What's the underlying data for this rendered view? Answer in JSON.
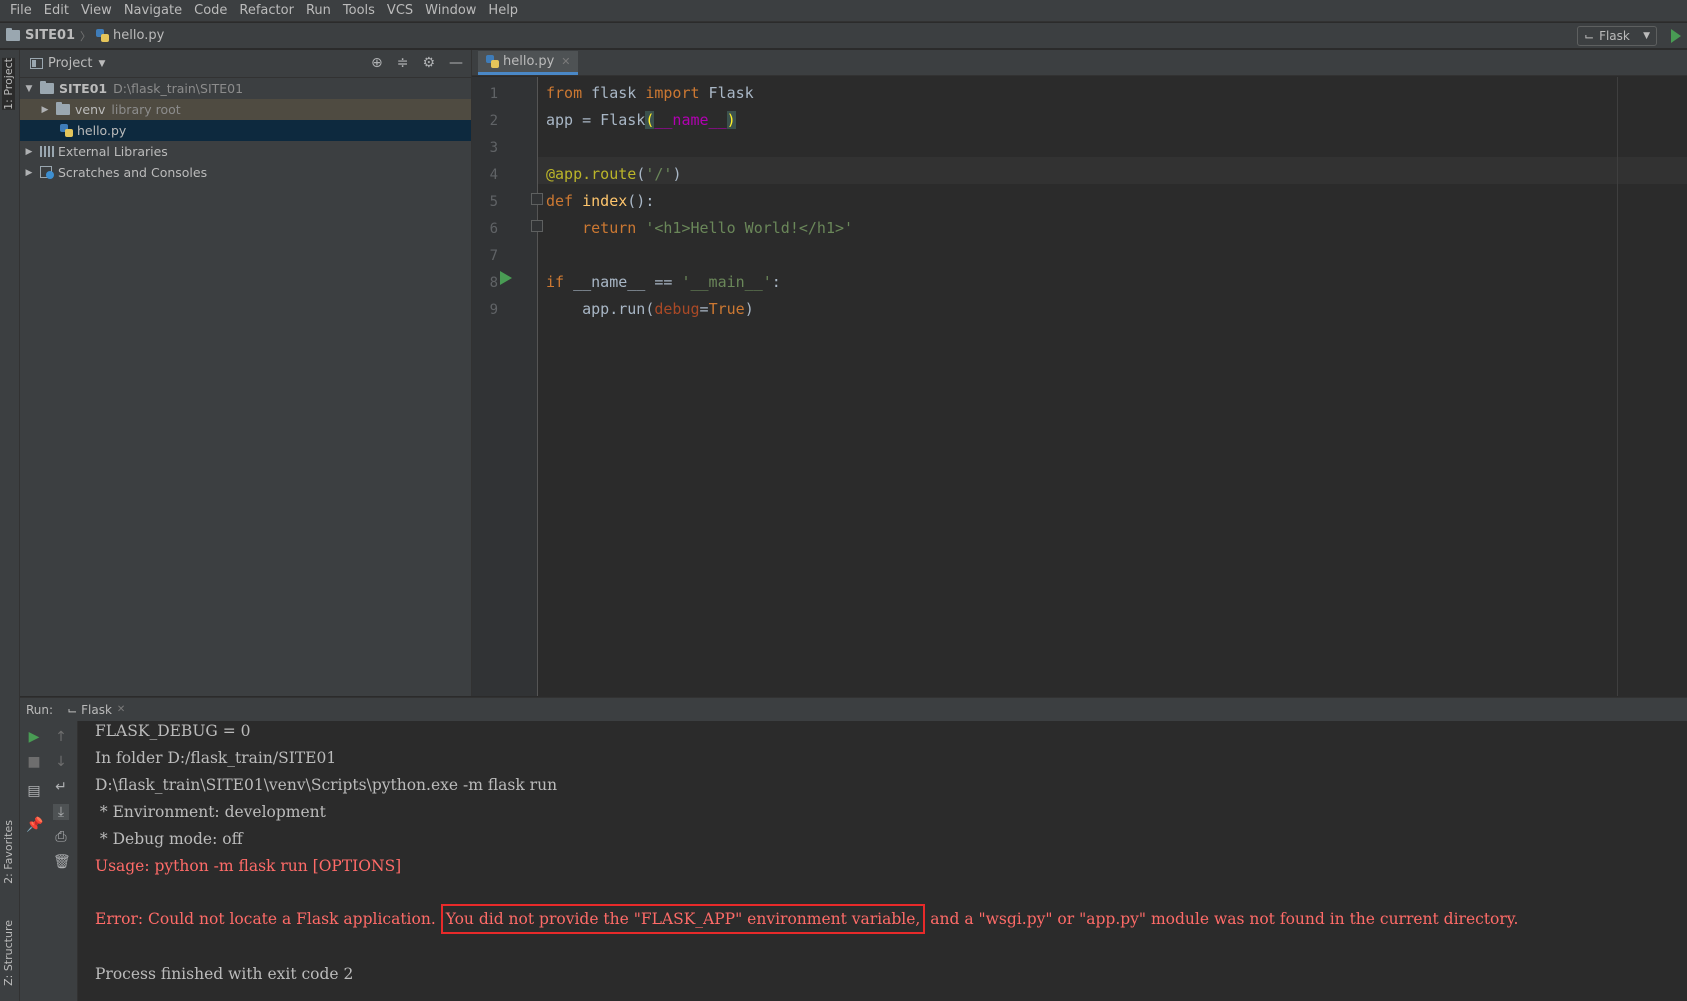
{
  "menu": [
    "File",
    "Edit",
    "View",
    "Navigate",
    "Code",
    "Refactor",
    "Run",
    "Tools",
    "VCS",
    "Window",
    "Help"
  ],
  "breadcrumb": {
    "project": "SITE01",
    "file": "hello.py"
  },
  "run_config": {
    "name": "Flask"
  },
  "left_tabs": {
    "project": "1: Project",
    "favorites": "2: Favorites",
    "structure": "Z: Structure"
  },
  "project_panel": {
    "title": "Project",
    "tree": {
      "root_name": "SITE01",
      "root_path": "D:\\flask_train\\SITE01",
      "venv_name": "venv",
      "venv_note": "library root",
      "file": "hello.py",
      "external": "External Libraries",
      "scratches": "Scratches and Consoles"
    }
  },
  "editor": {
    "tab": "hello.py",
    "line_numbers": [
      "1",
      "2",
      "3",
      "4",
      "5",
      "6",
      "7",
      "8",
      "9"
    ],
    "code": {
      "l1": {
        "kw1": "from",
        "mod": " flask ",
        "kw2": "import",
        "name": " Flask"
      },
      "l2": {
        "a": "app = Flask",
        "open": "(",
        "arg": "__name__",
        "close": ")"
      },
      "l4": {
        "dec": "@app.route",
        "open": "(",
        "str": "'/'",
        "close": ")"
      },
      "l5": {
        "kw": "def",
        "fn": " index",
        "rest": "():"
      },
      "l6": {
        "indent": "    ",
        "kw": "return",
        "sp": " ",
        "str": "'<h1>Hello World!</h1>'"
      },
      "l8": {
        "kw": "if",
        "a": " __name__ == ",
        "str": "'__main__'",
        "b": ":"
      },
      "l9": {
        "a": "    app.run(",
        "param": "debug",
        "eq": "=",
        "kw": "True",
        "close": ")"
      }
    }
  },
  "run_panel": {
    "label": "Run:",
    "tab": "Flask",
    "console": {
      "l1": "FLASK_DEBUG = 0",
      "l2": "In folder D:/flask_train/SITE01",
      "l3": "D:\\flask_train\\SITE01\\venv\\Scripts\\python.exe -m flask run",
      "l4": " * Environment: development",
      "l5": " * Debug mode: off",
      "l6": "Usage: python -m flask run [OPTIONS]",
      "l7a": "Error: Could not locate a Flask application.",
      "l7b": "You did not provide the \"FLASK_APP\" environment variable,",
      "l7c": "and a \"wsgi.py\" or \"app.py\" module was not found in the current directory.",
      "l8": "Process finished with exit code 2"
    }
  },
  "colors": {
    "error": "#ff6b68",
    "highlight_box": "#e82a2a",
    "run_green": "#499c54",
    "selection": "#0d293e"
  }
}
